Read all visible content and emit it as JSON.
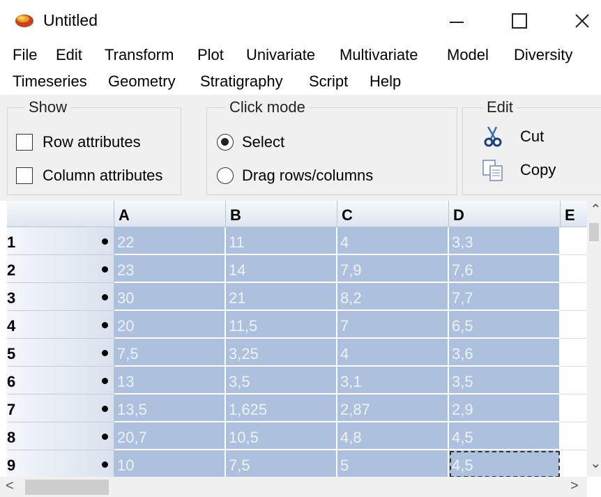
{
  "window": {
    "title": "Untitled"
  },
  "menu": {
    "row1": [
      "File",
      "Edit",
      "Transform",
      "Plot",
      "Univariate",
      "Multivariate",
      "Model",
      "Diversity"
    ],
    "row2": [
      "Timeseries",
      "Geometry",
      "Stratigraphy",
      "Script",
      "Help"
    ]
  },
  "show_group": {
    "legend": "Show",
    "row_attributes": "Row attributes",
    "column_attributes": "Column attributes"
  },
  "click_mode_group": {
    "legend": "Click mode",
    "select": "Select",
    "drag": "Drag rows/columns",
    "selected": "Select"
  },
  "edit_group": {
    "legend": "Edit",
    "cut": "Cut",
    "copy": "Copy"
  },
  "grid": {
    "columns": [
      "A",
      "B",
      "C",
      "D",
      "E"
    ],
    "rows": [
      {
        "num": "1",
        "cells": [
          "22",
          "11",
          "4",
          "3,3"
        ]
      },
      {
        "num": "2",
        "cells": [
          "23",
          "14",
          "7,9",
          "7,6"
        ]
      },
      {
        "num": "3",
        "cells": [
          "30",
          "21",
          "8,2",
          "7,7"
        ]
      },
      {
        "num": "4",
        "cells": [
          "20",
          "11,5",
          "7",
          "6,5"
        ]
      },
      {
        "num": "5",
        "cells": [
          "7,5",
          "3,25",
          "4",
          "3,6"
        ]
      },
      {
        "num": "6",
        "cells": [
          "13",
          "3,5",
          "3,1",
          "3,5"
        ]
      },
      {
        "num": "7",
        "cells": [
          "13,5",
          "1,625",
          "2,87",
          "2,9"
        ]
      },
      {
        "num": "8",
        "cells": [
          "20,7",
          "10,5",
          "4,8",
          "4,5"
        ]
      },
      {
        "num": "9",
        "cells": [
          "10",
          "7,5",
          "5",
          "4,5"
        ]
      }
    ]
  },
  "colors": {
    "selection": "#adc0dd",
    "selection_text": "#eef2f8",
    "header_gradient_end": "#dde5f0"
  }
}
